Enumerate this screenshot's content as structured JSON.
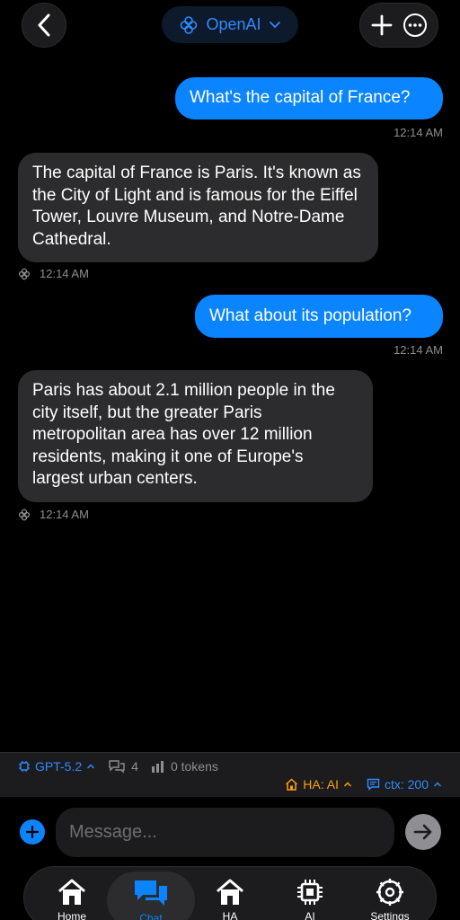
{
  "header": {
    "provider_label": "OpenAI",
    "icons": {
      "back": "chevron-left-icon",
      "provider": "openai-logo-icon",
      "dropdown": "chevron-down-icon",
      "new_chat": "plus-icon",
      "more": "more-circle-icon"
    }
  },
  "messages": [
    {
      "role": "user",
      "text": "What's the capital of France?",
      "time": "12:14 AM"
    },
    {
      "role": "assistant",
      "text": "The capital of France is Paris. It's known as the City of Light and is famous for the Eiffel Tower, Louvre Museum, and Notre-Dame Cathedral.",
      "time": "12:14 AM"
    },
    {
      "role": "user",
      "text": "What about its population?",
      "time": "12:14 AM"
    },
    {
      "role": "assistant",
      "text": "Paris has about 2.1 million people in the city itself, but the greater Paris metropolitan area has over 12 million residents, making it one of Europe's largest urban centers.",
      "time": "12:14 AM"
    }
  ],
  "status": {
    "model": "GPT-5.2",
    "message_count": "4",
    "tokens": "0 tokens",
    "ha_mode": "HA: AI",
    "ctx": "ctx: 200"
  },
  "composer": {
    "placeholder": "Message..."
  },
  "tabs": [
    {
      "label": "Home",
      "icon": "house-icon"
    },
    {
      "label": "Chat",
      "icon": "chat-bubbles-icon",
      "active": true
    },
    {
      "label": "HA",
      "icon": "home-assistant-icon"
    },
    {
      "label": "AI",
      "icon": "chip-icon"
    },
    {
      "label": "Settings",
      "icon": "gear-icon"
    }
  ],
  "colors": {
    "accent": "#0a84ff",
    "ha": "#ff9f0a",
    "user_bubble": "#0a84ff",
    "assistant_bubble": "#2c2c2e"
  }
}
